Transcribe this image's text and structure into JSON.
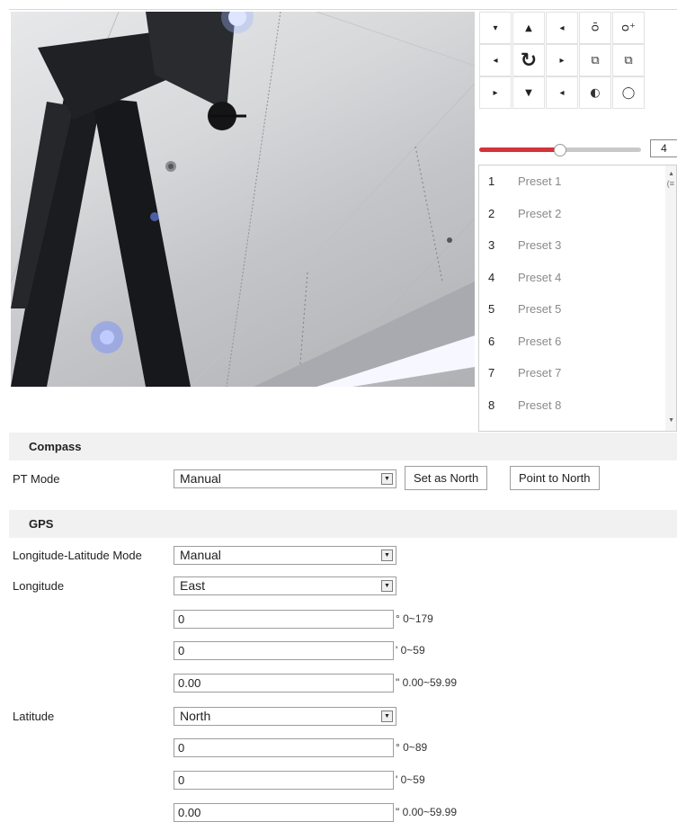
{
  "ptz": {
    "buttons": [
      {
        "name": "pan-up-left-button",
        "glyph": "▾"
      },
      {
        "name": "pan-up-button",
        "glyph": "▲"
      },
      {
        "name": "pan-up-right-button",
        "glyph": "◂"
      },
      {
        "name": "zoom-out-button",
        "glyph": "ᴑ̄"
      },
      {
        "name": "zoom-in-button",
        "glyph": "ᴑ⁺"
      },
      {
        "name": "pan-left-button",
        "glyph": "◂"
      },
      {
        "name": "auto-pan-button",
        "glyph": "↻"
      },
      {
        "name": "pan-right-button",
        "glyph": "▸"
      },
      {
        "name": "focus-near-button",
        "glyph": "⧉"
      },
      {
        "name": "focus-far-button",
        "glyph": "⧉"
      },
      {
        "name": "pan-down-left-button",
        "glyph": "▸"
      },
      {
        "name": "pan-down-button",
        "glyph": "▼"
      },
      {
        "name": "pan-down-right-button",
        "glyph": "◂"
      },
      {
        "name": "iris-close-button",
        "glyph": "◐"
      },
      {
        "name": "iris-open-button",
        "glyph": "◯"
      }
    ],
    "speed": {
      "value": "4",
      "fraction": 0.5
    }
  },
  "presets": [
    {
      "num": "1",
      "name": "Preset 1"
    },
    {
      "num": "2",
      "name": "Preset 2"
    },
    {
      "num": "3",
      "name": "Preset 3"
    },
    {
      "num": "4",
      "name": "Preset 4"
    },
    {
      "num": "5",
      "name": "Preset 5"
    },
    {
      "num": "6",
      "name": "Preset 6"
    },
    {
      "num": "7",
      "name": "Preset 7"
    },
    {
      "num": "8",
      "name": "Preset 8"
    }
  ],
  "compass": {
    "title": "Compass",
    "pt_mode_label": "PT Mode",
    "pt_mode_value": "Manual",
    "set_north_label": "Set as North",
    "point_north_label": "Point to North"
  },
  "gps": {
    "title": "GPS",
    "mode_label": "Longitude-Latitude Mode",
    "mode_value": "Manual",
    "longitude_label": "Longitude",
    "longitude_dir": "East",
    "lon_deg": "0",
    "lon_deg_unit": "° 0~179",
    "lon_min": "0",
    "lon_min_unit": "' 0~59",
    "lon_sec": "0.00",
    "lon_sec_unit": "\" 0.00~59.99",
    "latitude_label": "Latitude",
    "latitude_dir": "North",
    "lat_deg": "0",
    "lat_deg_unit": "° 0~89",
    "lat_min": "0",
    "lat_min_unit": "' 0~59",
    "lat_sec": "0.00",
    "lat_sec_unit": "\" 0.00~59.99"
  },
  "colors": {
    "slider_fill": "#d6323a",
    "section_bg": "#f1f1f1"
  }
}
